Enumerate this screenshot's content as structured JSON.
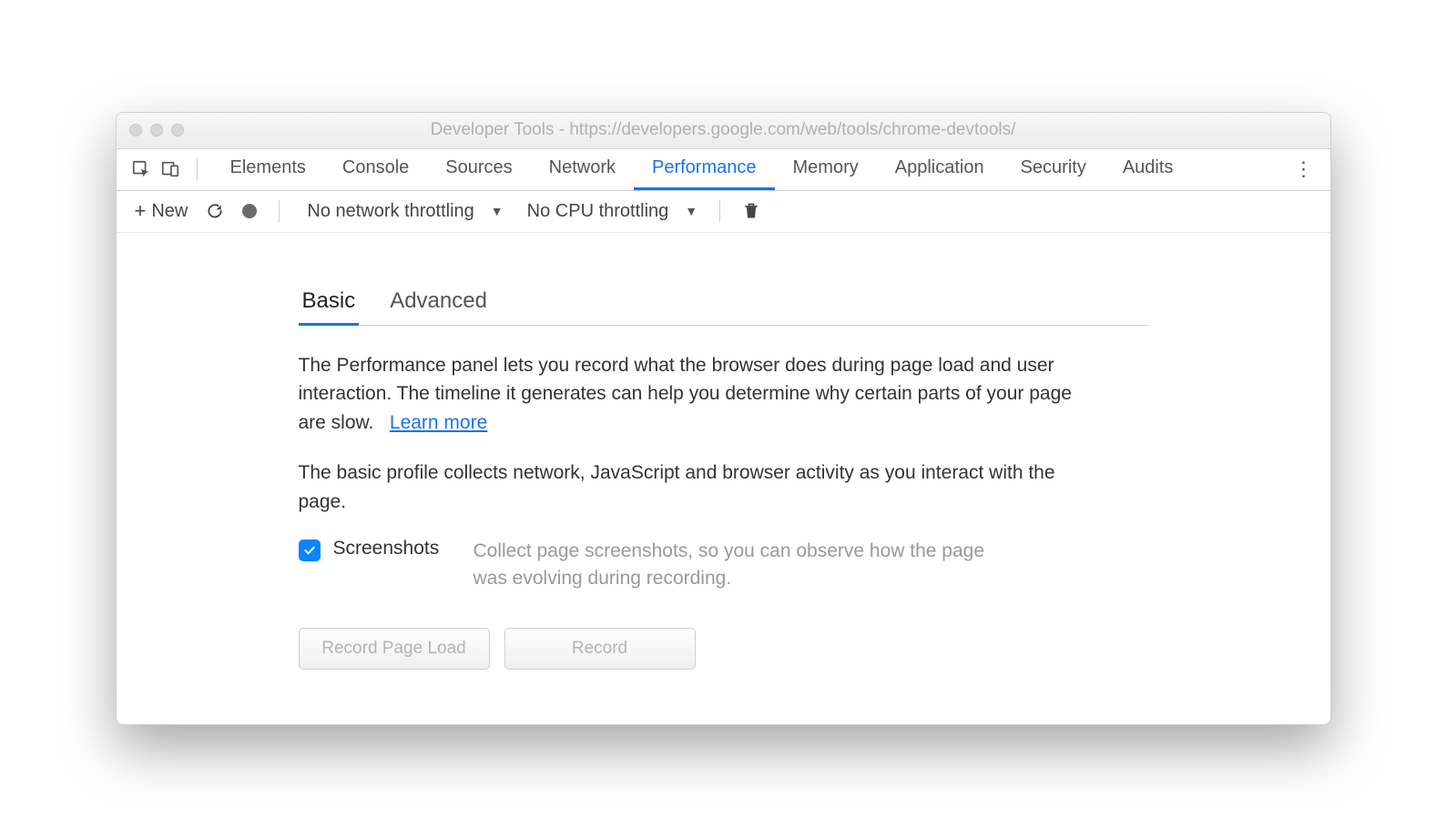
{
  "window": {
    "title": "Developer Tools - https://developers.google.com/web/tools/chrome-devtools/"
  },
  "tabbar": {
    "tabs": [
      "Elements",
      "Console",
      "Sources",
      "Network",
      "Performance",
      "Memory",
      "Application",
      "Security",
      "Audits"
    ],
    "active": "Performance"
  },
  "toolbar": {
    "new_label": "New",
    "network_dropdown": "No network throttling",
    "cpu_dropdown": "No CPU throttling"
  },
  "panel": {
    "subtabs": [
      "Basic",
      "Advanced"
    ],
    "active_subtab": "Basic",
    "intro": "The Performance panel lets you record what the browser does during page load and user interaction. The timeline it generates can help you determine why certain parts of your page are slow.",
    "learn_more": "Learn more",
    "basic_desc": "The basic profile collects network, JavaScript and browser activity as you interact with the page.",
    "option": {
      "label": "Screenshots",
      "description": "Collect page screenshots, so you can observe how the page was evolving during recording.",
      "checked": true
    },
    "buttons": {
      "record_page_load": "Record Page Load",
      "record": "Record"
    }
  }
}
